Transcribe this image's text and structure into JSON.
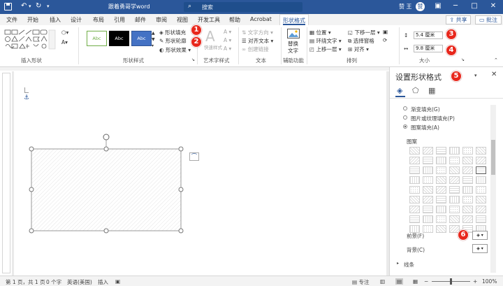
{
  "titlebar": {
    "doc_title": "跟着勇哥学word",
    "search_placeholder": "搜索",
    "user": "赞 王",
    "avatar_initial": "赞"
  },
  "tabs": [
    "文件",
    "开始",
    "插入",
    "设计",
    "布局",
    "引用",
    "邮件",
    "审阅",
    "视图",
    "开发工具",
    "帮助",
    "Acrobat",
    "形状格式"
  ],
  "active_tab": "形状格式",
  "share_label": "共享",
  "comment_label": "批注",
  "ribbon": {
    "groups": [
      "插入形状",
      "形状样式",
      "艺术字样式",
      "文本",
      "辅助功能",
      "排列",
      "大小"
    ],
    "style_sample": "Abc",
    "shape_fill": "形状填充",
    "shape_outline": "形状轮廓",
    "shape_effects": "形状效果",
    "quick_styles": "快速样式",
    "text_direction": "文字方向",
    "align_text": "对齐文本",
    "create_link": "创建链接",
    "alt_text_1": "替换",
    "alt_text_2": "文字",
    "position": "位置",
    "wrap_text": "环绕文字",
    "bring_forward": "上移一层",
    "send_backward": "下移一层",
    "selection_pane": "选择窗格",
    "align": "对齐",
    "height": "5.4 厘米",
    "width": "9.8 厘米"
  },
  "badges": [
    "1",
    "2",
    "3",
    "4",
    "5",
    "6"
  ],
  "pane": {
    "title": "设置形状格式",
    "gradient_fill": "渐变填充(G)",
    "picture_fill": "图片或纹理填充(P)",
    "pattern_fill": "图案填充(A)",
    "pattern_label": "图案",
    "foreground": "前景(F)",
    "background": "背景(C)",
    "line": "线条"
  },
  "status": {
    "page": "第 1 页，共 1 页",
    "words": "0 个字",
    "language": "英语(美国)",
    "mode": "插入",
    "focus": "专注",
    "zoom": "100%"
  },
  "colors": {
    "titlebar": "#2b579a",
    "accent_blue": "#4472c4",
    "badge": "#e8271c"
  }
}
